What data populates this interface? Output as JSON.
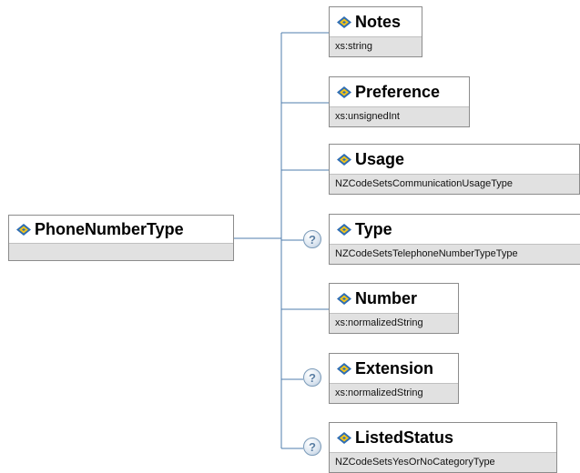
{
  "root": {
    "name": "PhoneNumberType",
    "icon": "element-diamond-icon"
  },
  "children": [
    {
      "name": "Notes",
      "type": "xs:string",
      "optional": false
    },
    {
      "name": "Preference",
      "type": "xs:unsignedInt",
      "optional": false
    },
    {
      "name": "Usage",
      "type": "NZCodeSetsCommunicationUsageType",
      "optional": false
    },
    {
      "name": "Type",
      "type": "NZCodeSetsTelephoneNumberTypeType",
      "optional": true
    },
    {
      "name": "Number",
      "type": "xs:normalizedString",
      "optional": false
    },
    {
      "name": "Extension",
      "type": "xs:normalizedString",
      "optional": true
    },
    {
      "name": "ListedStatus",
      "type": "NZCodeSetsYesOrNoCategoryType",
      "optional": true
    }
  ],
  "optional_marker": "?",
  "colors": {
    "connector": "#4f7cad",
    "box_border": "#8c8c8c",
    "type_bar": "#e1e1e1",
    "icon_blue": "#2e6db4",
    "icon_yellow": "#f2c419"
  }
}
